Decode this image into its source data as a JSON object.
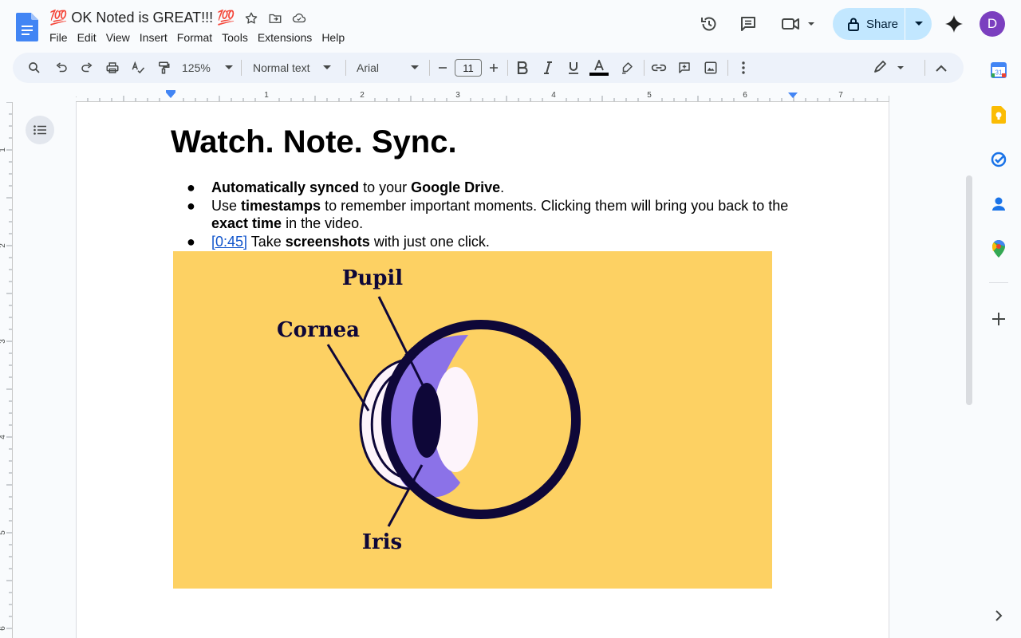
{
  "app": {
    "title": "💯 OK Noted is GREAT!!! 💯",
    "menu": [
      "File",
      "Edit",
      "View",
      "Insert",
      "Format",
      "Tools",
      "Extensions",
      "Help"
    ],
    "share_label": "Share",
    "avatar_initial": "D"
  },
  "toolbar": {
    "zoom": "125%",
    "style": "Normal text",
    "font": "Arial",
    "font_size": "11"
  },
  "ruler": {
    "labels": [
      "1",
      "1",
      "2",
      "3",
      "4",
      "5",
      "6",
      "7"
    ],
    "vlabels": [
      "1",
      "2",
      "3",
      "4",
      "5",
      "6"
    ]
  },
  "document": {
    "heading": "Watch. Note. Sync.",
    "bullets": {
      "b1_strong1": "Automatically synced",
      "b1_text1": " to your ",
      "b1_strong2": "Google Drive",
      "b1_text2": ".",
      "b2_text1": "Use ",
      "b2_strong1": "timestamps",
      "b2_text2": " to remember important moments. Clicking them will bring you back to the ",
      "b2_strong2": "exact time",
      "b2_text3": " in the video.",
      "b3_link": "[0:45]",
      "b3_text1": " Take ",
      "b3_strong1": "screenshots",
      "b3_text2": " with just one click."
    },
    "bullet_glyph": "●",
    "image_labels": {
      "pupil": "Pupil",
      "cornea": "Cornea",
      "iris": "Iris"
    }
  },
  "colors": {
    "image_bg": "#fdd163",
    "share_bg": "#c2e7ff",
    "iris": "#8b72e8",
    "dark": "#0e0738",
    "lens": "#fdf4fb",
    "link": "#1155cc"
  },
  "icons": {
    "topbar": [
      "history-icon",
      "comment-icon",
      "meet-icon",
      "lock-icon",
      "gemini-icon"
    ],
    "side": [
      "calendar-icon",
      "keep-icon",
      "tasks-icon",
      "contacts-icon",
      "maps-icon",
      "add-icon"
    ]
  }
}
